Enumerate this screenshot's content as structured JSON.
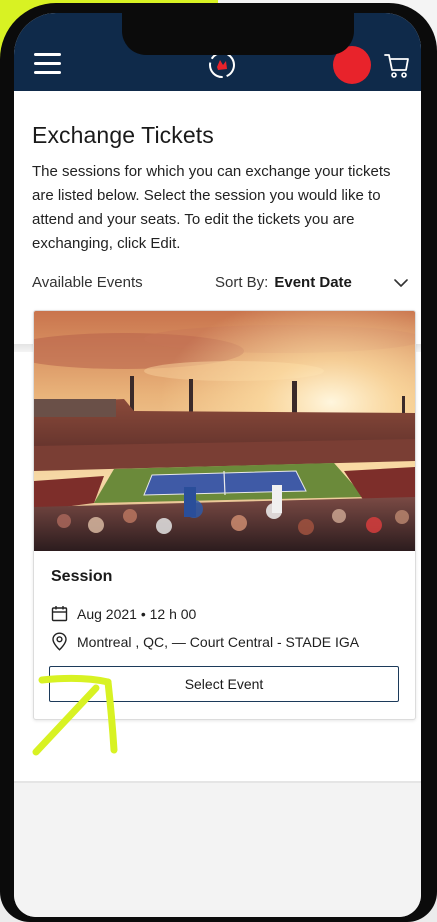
{
  "page": {
    "title": "Exchange Tickets",
    "intro": "The sessions for which you can exchange your tickets are listed below. Select the session you would like to attend and your seats. To edit the tickets you are exchanging, click Edit."
  },
  "appbar": {
    "menu_icon": "hamburger-menu-icon",
    "logo_icon": "brand-logo-icon",
    "avatar_color": "#e8232b",
    "cart_icon": "cart-icon",
    "background": "#0f2a4a"
  },
  "list": {
    "available_label": "Available Events",
    "sort_label": "Sort By:",
    "sort_value": "Event Date",
    "sort_icon": "chevron-down-icon"
  },
  "events": [
    {
      "name": "Session",
      "date_icon": "calendar-icon",
      "date": "Aug 2021 • 12 h 00",
      "venue_icon": "location-pin-icon",
      "venue": "Montreal , QC, — Court Central - STADE IGA",
      "button_label": "Select Event"
    }
  ],
  "annotation": {
    "arrow_color": "#d8f223"
  }
}
